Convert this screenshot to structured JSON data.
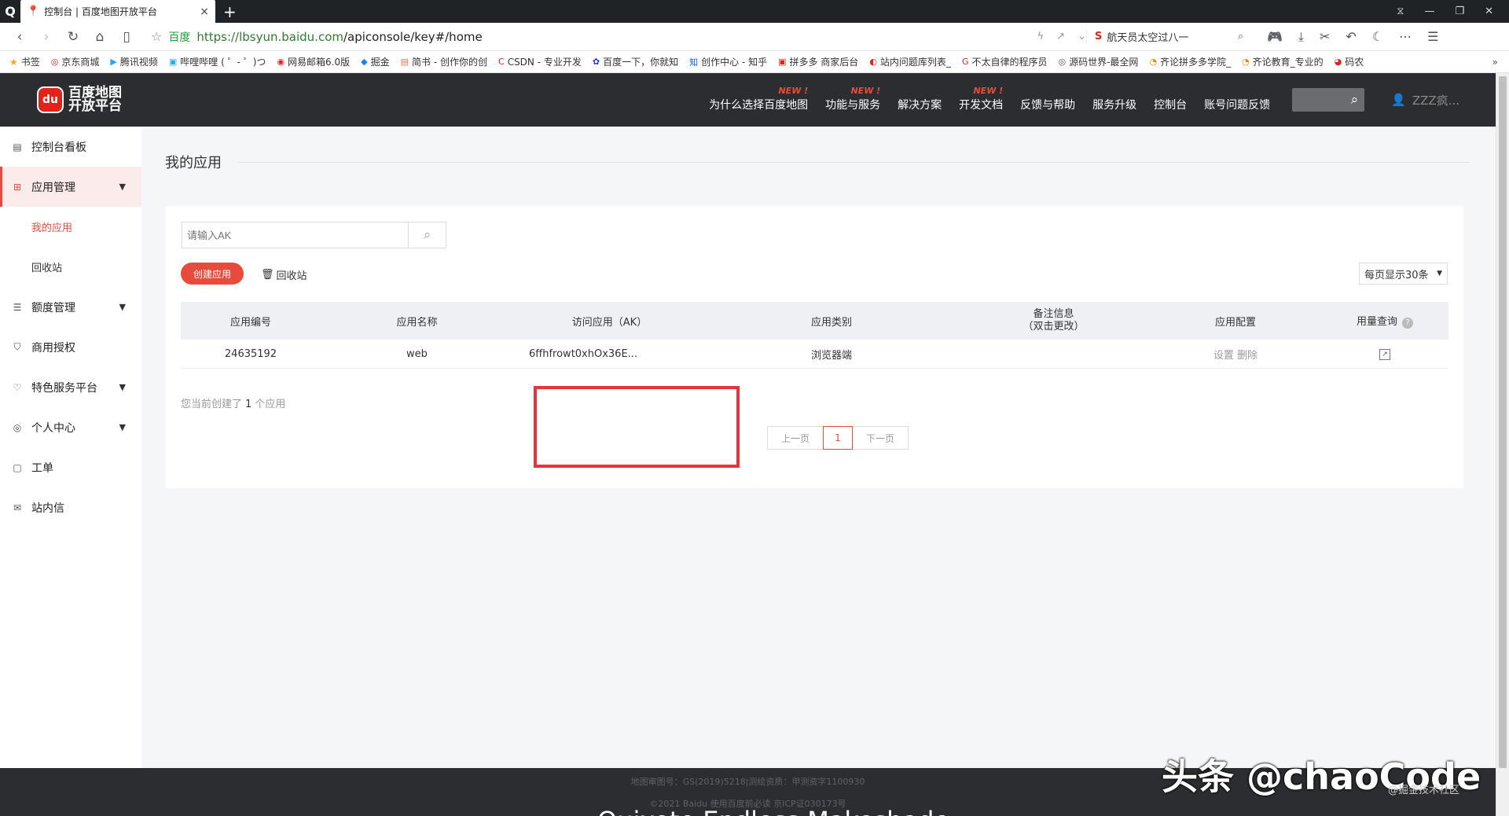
{
  "browser": {
    "logo": "Q",
    "tab_title": "控制台 | 百度地图开放平台",
    "tab_close": "×",
    "new_tab": "+",
    "window_controls": [
      "⧖",
      "—",
      "❐",
      "✕"
    ],
    "site_label": "百度",
    "url_host": "https://lbsyun.baidu.com",
    "url_path": "/apiconsole/key#/home",
    "search_text": "航天员太空过八一",
    "search_engine_icon": "S",
    "bookmarks": [
      "书签",
      "京东商城",
      "腾讯视频",
      "哔哩哔哩 ( ゜- ゜)つ",
      "网易邮箱6.0版",
      "掘金",
      "简书 - 创作你的创",
      "CSDN - 专业开发",
      "百度一下，你就知",
      "创作中心 - 知乎",
      "拼多多 商家后台",
      "站内问题库列表_",
      "不太自律的程序员",
      "源码世界-最全网",
      "齐论拼多多学院_",
      "齐论教育_专业的",
      "码农"
    ],
    "bookmarks_more": "»"
  },
  "header": {
    "logo_mark": "du",
    "logo_text": "百度地图开放平台",
    "nav": [
      {
        "label": "为什么选择百度地图",
        "badge": "NEW !"
      },
      {
        "label": "功能与服务",
        "badge": "NEW !"
      },
      {
        "label": "解决方案",
        "badge": ""
      },
      {
        "label": "开发文档",
        "badge": "NEW !"
      },
      {
        "label": "反馈与帮助",
        "badge": ""
      },
      {
        "label": "服务升级",
        "badge": ""
      },
      {
        "label": "控制台",
        "badge": ""
      },
      {
        "label": "账号问题反馈",
        "badge": ""
      }
    ],
    "username": "ZZZ疯..."
  },
  "sidebar": {
    "items": [
      {
        "label": "控制台看板"
      },
      {
        "label": "应用管理"
      },
      {
        "label": "我的应用"
      },
      {
        "label": "回收站"
      },
      {
        "label": "额度管理"
      },
      {
        "label": "商用授权"
      },
      {
        "label": "特色服务平台"
      },
      {
        "label": "个人中心"
      },
      {
        "label": "工单"
      },
      {
        "label": "站内信"
      }
    ]
  },
  "main": {
    "page_title": "我的应用",
    "search_placeholder": "请输入AK",
    "create_button": "创建应用",
    "recycle_link": "回收站",
    "per_page": "每页显示30条",
    "columns": [
      "应用编号",
      "应用名称",
      "访问应用（AK）",
      "应用类别",
      "备注信息",
      "（双击更改）",
      "应用配置",
      "用量查询"
    ],
    "rows": [
      {
        "id": "24635192",
        "name": "web",
        "ak": "6ffhfrowt0xhOx36E...",
        "category": "浏览器端",
        "remark": "",
        "config_set": "设置",
        "config_delete": "删除"
      }
    ],
    "summary_prefix": "您当前创建了",
    "summary_count": "1",
    "summary_suffix": "个应用",
    "pager": {
      "prev": "上一页",
      "current": "1",
      "next": "下一页"
    }
  },
  "footer": {
    "line1": "地图审图号：GS(2019)5218|测绘资质：甲测资字1100930",
    "line2": "©2021 Baidu 使用百度前必读 京ICP证030173号",
    "overflow_text": "Quixote Endless Makeshade"
  },
  "watermark": {
    "main": "头条 @chaoCode",
    "sub": "@掘金技术社区"
  }
}
